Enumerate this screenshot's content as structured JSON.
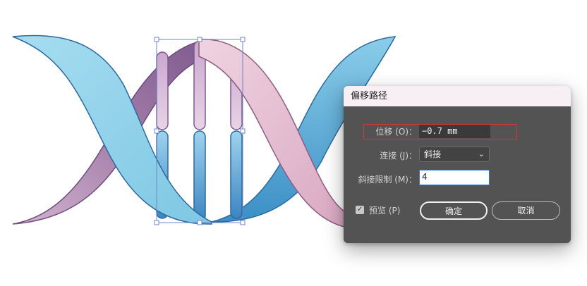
{
  "dialog": {
    "title": "偏移路径",
    "offset_label": "位移 (O)：",
    "offset_value": "−0.7 mm",
    "join_label": "连接 (J)：",
    "join_value": "斜接",
    "miter_limit_label": "斜接限制 (M)：",
    "miter_limit_value": "4",
    "preview_label": "预览 (P)",
    "preview_checked": true,
    "ok_label": "确定",
    "cancel_label": "取消"
  },
  "colors": {
    "dialog_bg": "#535353",
    "highlight": "#d9362f",
    "blue_ribbon": "#8fd0ea",
    "purple_ribbon": "#9b6fa0",
    "pink_ribbon": "#e8c5d6",
    "selection": "#6f86c9"
  },
  "icons": {
    "chevron": "chevron-down-icon",
    "check": "checkmark-icon"
  }
}
